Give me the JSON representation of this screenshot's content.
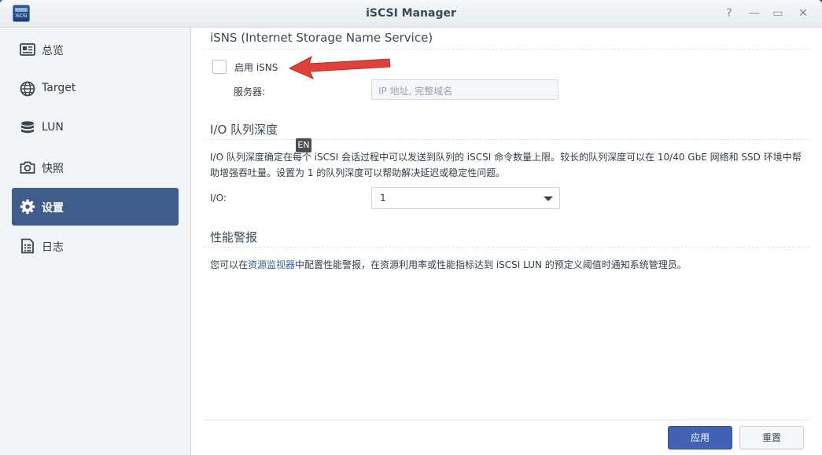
{
  "window": {
    "title": "iSCSI Manager",
    "app_icon_text": "iSCSI",
    "controls": {
      "help": "?",
      "minimize": "—",
      "maximize": "▭",
      "close": "✕"
    }
  },
  "sidebar": {
    "items": [
      {
        "label": "总览",
        "icon": "overview-card-icon",
        "active": false
      },
      {
        "label": "Target",
        "icon": "globe-icon",
        "active": false
      },
      {
        "label": "LUN",
        "icon": "database-icon",
        "active": false
      },
      {
        "label": "快照",
        "icon": "camera-icon",
        "active": false
      },
      {
        "label": "设置",
        "icon": "gear-icon",
        "active": true
      },
      {
        "label": "日志",
        "icon": "log-document-icon",
        "active": false
      }
    ]
  },
  "isns": {
    "title": "iSNS (Internet Storage Name Service)",
    "enable_label": "启用 iSNS",
    "enable_checked": false,
    "server_label": "服务器:",
    "server_placeholder": "IP 地址, 完整域名",
    "server_value": ""
  },
  "io": {
    "title": "I/O 队列深度",
    "description": "I/O 队列深度确定在每个 iSCSI 会话过程中可以发送到队列的 iSCSI 命令数量上限。较长的队列深度可以在 10/40 GbE 网络和 SSD 环境中帮助增强吞吐量。设置为 1 的队列深度可以帮助解决延迟或稳定性问题。",
    "select_label": "I/O:",
    "select_value": "1"
  },
  "perf": {
    "title": "性能警报",
    "desc_prefix": "您可以在",
    "desc_link": "资源监视器",
    "desc_suffix": "中配置性能警报，在资源利用率或性能指标达到 iSCSI LUN 的预定义阈值时通知系统管理员。"
  },
  "footer": {
    "apply_label": "应用",
    "reset_label": "重置"
  },
  "overlay": {
    "ime_badge": "EN",
    "annotation_arrow_color": "#e0413a"
  },
  "colors": {
    "accent": "#3f5c8c",
    "primary_button": "#3f63b2",
    "link": "#2e5ea8"
  }
}
